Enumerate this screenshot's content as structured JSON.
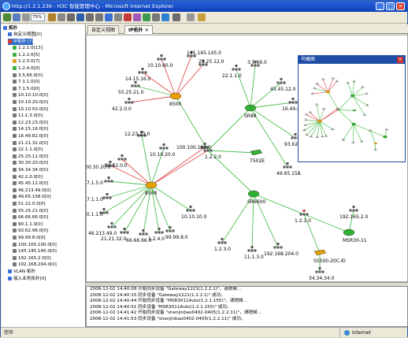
{
  "window": {
    "title": "http://1.2.1.236 - H3C 智能管理中心 - Microsoft Internet Explorer",
    "minimize_icon": "_",
    "maximize_icon": "□",
    "close_icon": "×"
  },
  "toolbar": {
    "zoom_value": "75%"
  },
  "sidebar": {
    "root_label": "拓扑",
    "items": [
      {
        "label": "自定义视图[0]",
        "indent": 1,
        "color": "#3a6fd8"
      },
      {
        "label": "IP拓扑 [?]",
        "indent": 1,
        "color": "#d83a3a",
        "selected": true
      },
      {
        "label": "1.2.1.0[13]",
        "indent": 2,
        "color": "#3cb043"
      },
      {
        "label": "1.2.2.0[5]",
        "indent": 2,
        "color": "#3cb043"
      },
      {
        "label": "1.2.3.0[7]",
        "indent": 2,
        "color": "#e0a020"
      },
      {
        "label": "1.2.4.0[0]",
        "indent": 2,
        "color": "#3cb043"
      },
      {
        "label": "3.5.66.0[0]",
        "indent": 2,
        "color": "#777"
      },
      {
        "label": "7.1.1.0[0]",
        "indent": 2,
        "color": "#777"
      },
      {
        "label": "7.1.5.0[0]",
        "indent": 2,
        "color": "#777"
      },
      {
        "label": "10.10.10.0[0]",
        "indent": 2,
        "color": "#777"
      },
      {
        "label": "10.10.20.0[0]",
        "indent": 2,
        "color": "#777"
      },
      {
        "label": "10.10.50.0[0]",
        "indent": 2,
        "color": "#777"
      },
      {
        "label": "11.1.3.0[0]",
        "indent": 2,
        "color": "#777"
      },
      {
        "label": "12.23.23.0[0]",
        "indent": 2,
        "color": "#777"
      },
      {
        "label": "14.15.16.0[0]",
        "indent": 2,
        "color": "#777"
      },
      {
        "label": "16.49.82.0[0]",
        "indent": 2,
        "color": "#777"
      },
      {
        "label": "21.21.32.0[0]",
        "indent": 2,
        "color": "#777"
      },
      {
        "label": "22.1.1.0[0]",
        "indent": 2,
        "color": "#777"
      },
      {
        "label": "25.25.12.0[0]",
        "indent": 2,
        "color": "#777"
      },
      {
        "label": "30.30.20.0[0]",
        "indent": 2,
        "color": "#777"
      },
      {
        "label": "34.34.34.0[0]",
        "indent": 2,
        "color": "#777"
      },
      {
        "label": "42.2.0.0[0]",
        "indent": 2,
        "color": "#777"
      },
      {
        "label": "45.45.12.0[0]",
        "indent": 2,
        "color": "#777"
      },
      {
        "label": "46.213.49.0[0]",
        "indent": 2,
        "color": "#777"
      },
      {
        "label": "49.65.158.0[0]",
        "indent": 2,
        "color": "#777"
      },
      {
        "label": "51.22.0.0[0]",
        "indent": 2,
        "color": "#777"
      },
      {
        "label": "55.25.21.0[0]",
        "indent": 2,
        "color": "#777"
      },
      {
        "label": "66.66.66.0[0]",
        "indent": 2,
        "color": "#777"
      },
      {
        "label": "90.1.1.0[0]",
        "indent": 2,
        "color": "#777"
      },
      {
        "label": "93.62.96.0[0]",
        "indent": 2,
        "color": "#777"
      },
      {
        "label": "99.99.8.0[0]",
        "indent": 2,
        "color": "#777"
      },
      {
        "label": "100.100.100.0[0]",
        "indent": 2,
        "color": "#777"
      },
      {
        "label": "145.145.145.0[0]",
        "indent": 2,
        "color": "#777"
      },
      {
        "label": "192.165.2.0[0]",
        "indent": 2,
        "color": "#777"
      },
      {
        "label": "192.168.204.0[0]",
        "indent": 2,
        "color": "#777"
      },
      {
        "label": "VLAN 拓扑",
        "indent": 1,
        "color": "#3a6fd8"
      },
      {
        "label": "接入业务拓扑[0]",
        "indent": 1,
        "color": "#3a6fd8"
      }
    ]
  },
  "tabs": [
    {
      "label": "自定义视图",
      "active": false
    },
    {
      "label": "IP拓扑",
      "active": true
    }
  ],
  "topology": {
    "devices": [
      {
        "id": "d8500",
        "label": "8500",
        "type": "router",
        "color": "#e8a000"
      },
      {
        "id": "d8508",
        "label": "8508",
        "type": "router",
        "color": "#e8a000"
      },
      {
        "id": "sr88",
        "label": "SR88",
        "type": "router",
        "color": "#30b030"
      },
      {
        "id": "sr6600",
        "label": "SR6600",
        "type": "router",
        "color": "#30b030"
      },
      {
        "id": "d7502e",
        "label": "7502E",
        "type": "switch",
        "color": "#30b030"
      },
      {
        "id": "s5500",
        "label": "S5500-20C-EI",
        "type": "switch",
        "color": "#e8a000"
      },
      {
        "id": "msr",
        "label": "MSR30-11",
        "type": "router",
        "color": "#30b030"
      }
    ],
    "subnets": [
      "10.10.60.0",
      "145.145.145.0",
      "14.15.16.0",
      "25.25.12.0",
      "55.25.21.0",
      "42.2.0.0",
      "22.1.1.0",
      "3.5.66.0",
      "45.45.12.0",
      "16.49.82.0",
      "93.62.9",
      "49.65.158.",
      "12.23.23.0",
      "10.10.20.0",
      "100.100.100.0",
      "1.2.2.0",
      "51.22.0.0",
      "30.30.20.0",
      "7.1.5.0",
      "7.1.1.0",
      "90.1.1.0",
      "46.213.49.0",
      "21.21.32.0",
      "66.66.66.0",
      "1.2.4.0",
      "99.99.8.0",
      "10.10.10.0",
      "1.2.1.0",
      "192.165.2.0",
      "1.2.3.0",
      "11.1.3.0",
      "192.168.204.0",
      "34.34.34.0"
    ]
  },
  "birdseye": {
    "title": "鸟瞰图",
    "close_icon": "×"
  },
  "log": {
    "entries": [
      "2008-12-02 14:40:08  开始同步设备 \"Gateway1221(1.2.2.1)\"，请稍候...",
      "2008-12-02 14:40:15  同步设备 \"Gateway1221(1.2.2.1)\" 成功。",
      "2008-12-02 14:40:44  开始同步设备 \"MSR3011Auto(1.2.1.155)\"，请稍候...",
      "2008-12-02 14:40:51  同步设备 \"MSR3011Auto(1.2.1.155)\" 成功。",
      "2008-12-02 14:41:42  开始同步设备 \"shenjinbao0402-0405(1.2.2.11)\"，请稍候...",
      "2008-12-02 14:41:53  同步设备 \"shenjinbao0402-0405(1.2.2.11)\" 成功。"
    ]
  },
  "status": {
    "left": "完毕",
    "zone": "Internet"
  }
}
